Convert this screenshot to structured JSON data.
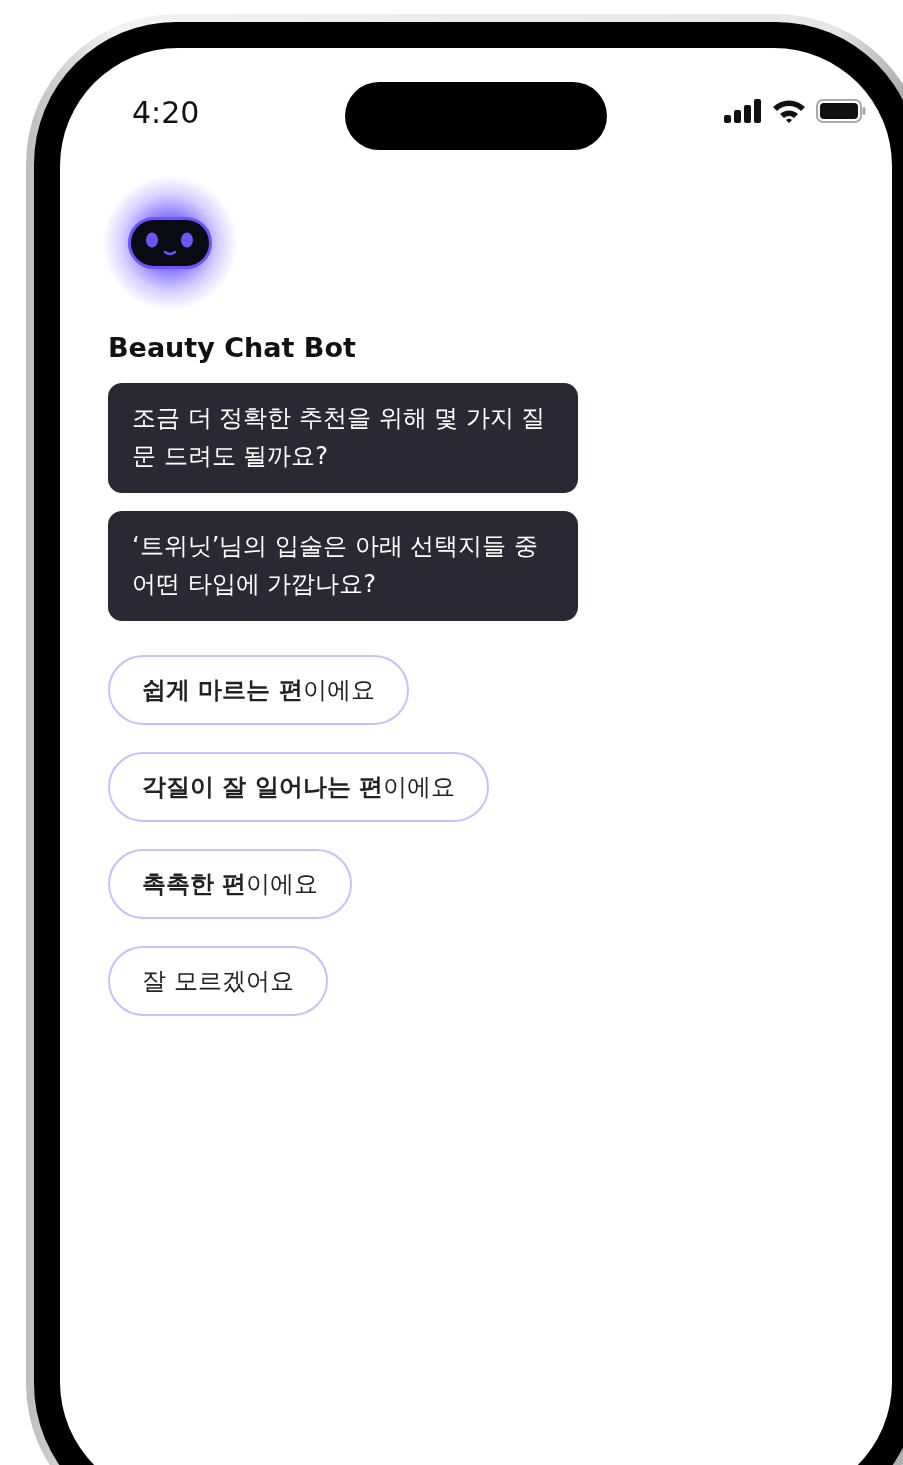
{
  "status_bar": {
    "time": "4:20"
  },
  "bot": {
    "name": "Beauty Chat Bot"
  },
  "messages": [
    {
      "text": "조금 더 정확한 추천을 위해 몇 가지 질문 드려도 될까요?"
    },
    {
      "text": "‘트위닛’님의 입술은 아래 선택지들 중 어떤 타입에 가깝나요?"
    }
  ],
  "quick_replies": [
    {
      "text": "**쉽게 마르는 편**이에요"
    },
    {
      "text": "**각질이 잘 일어나는 편**이에요"
    },
    {
      "text": "**촉촉한 편**이에요"
    },
    {
      "text": "잘 모르겠어요"
    }
  ]
}
